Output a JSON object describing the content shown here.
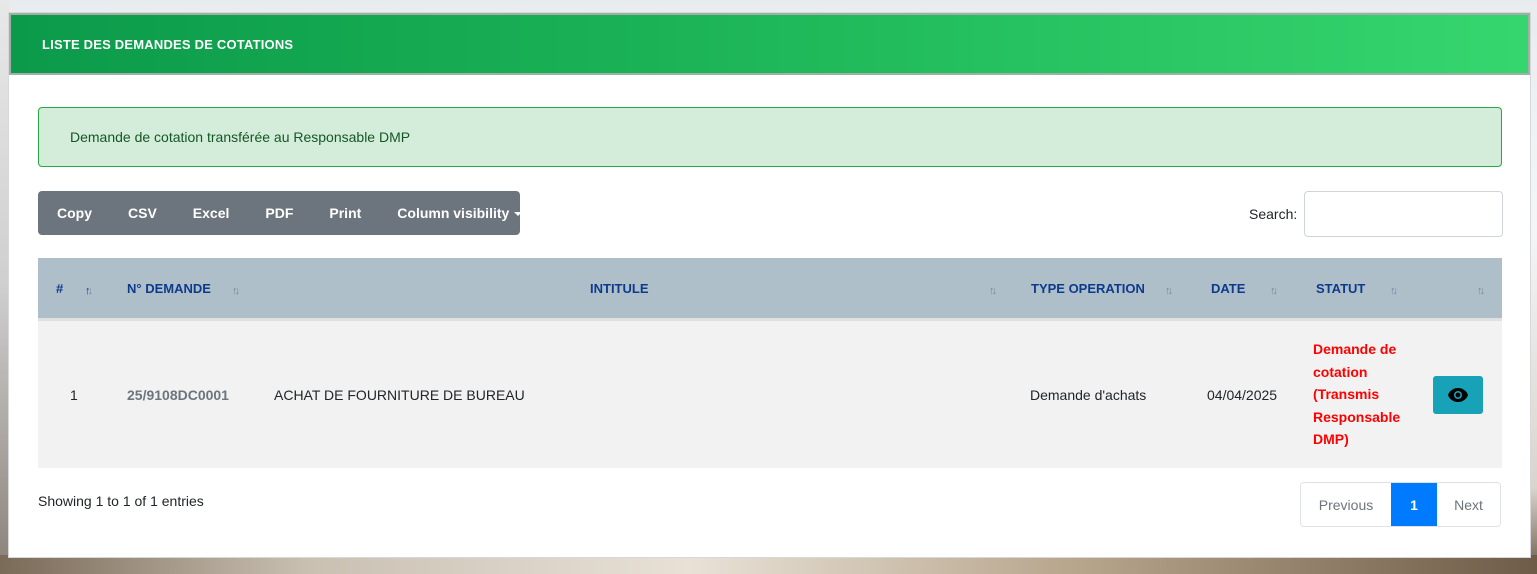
{
  "header": {
    "title": "LISTE DES DEMANDES DE COTATIONS"
  },
  "alert": {
    "message": "Demande de cotation transférée au Responsable DMP"
  },
  "toolbar": {
    "buttons": [
      "Copy",
      "CSV",
      "Excel",
      "PDF",
      "Print",
      "Column visibility"
    ]
  },
  "search": {
    "label": "Search:",
    "value": "",
    "placeholder": ""
  },
  "table": {
    "columns": [
      "#",
      "N° DEMANDE",
      "INTITULE",
      "TYPE OPERATION",
      "DATE",
      "STATUT",
      ""
    ],
    "rows": [
      {
        "index": "1",
        "numero": "25/9108DC0001",
        "intitule": "ACHAT DE FOURNITURE DE BUREAU",
        "type_operation": "Demande d'achats",
        "date": "04/04/2025",
        "statut_lines": [
          "Demande de",
          "cotation",
          "(Transmis",
          "Responsable",
          "DMP)"
        ],
        "action_icon": "eye-icon"
      }
    ]
  },
  "footer": {
    "info": "Showing 1 to 1 of 1 entries"
  },
  "pagination": {
    "previous": "Previous",
    "current": "1",
    "next": "Next"
  },
  "colors": {
    "header_green": "#1cb457",
    "alert_bg": "#d4edda",
    "button_gray": "#6c757d",
    "table_head": "#aebfca",
    "status_red": "#ff0000",
    "action_teal": "#17a2b8",
    "page_active": "#007bff"
  }
}
